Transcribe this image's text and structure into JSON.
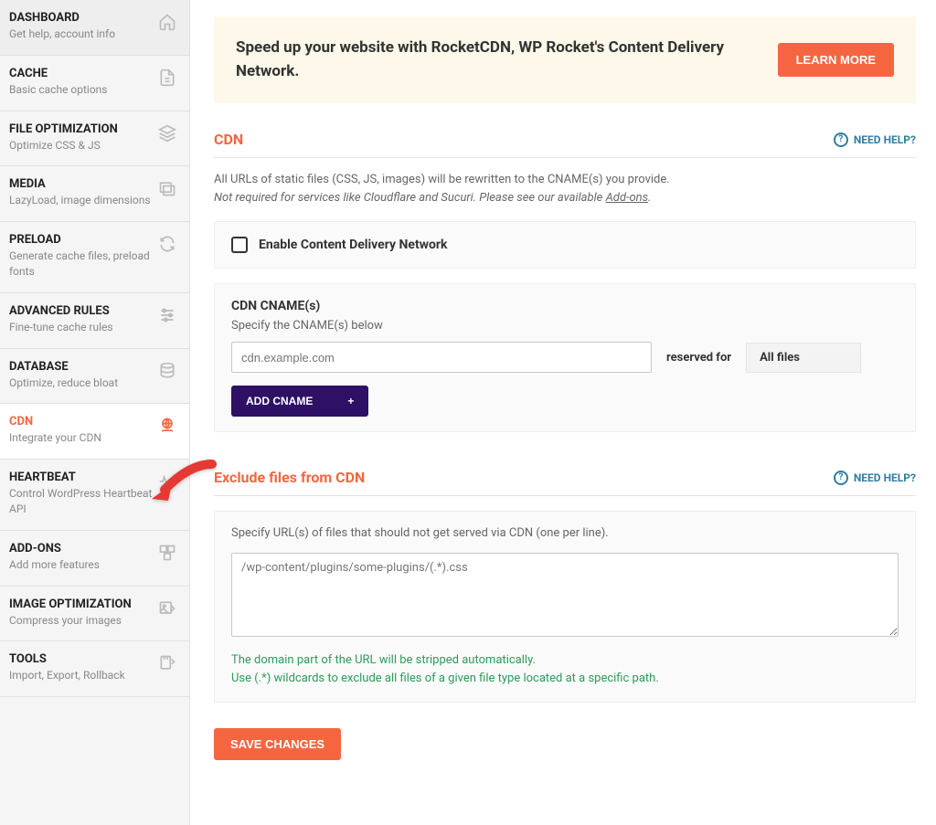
{
  "sidebar": {
    "items": [
      {
        "title": "DASHBOARD",
        "sub": "Get help, account info",
        "icon": "home"
      },
      {
        "title": "CACHE",
        "sub": "Basic cache options",
        "icon": "file"
      },
      {
        "title": "FILE OPTIMIZATION",
        "sub": "Optimize CSS & JS",
        "icon": "layers"
      },
      {
        "title": "MEDIA",
        "sub": "LazyLoad, image dimensions",
        "icon": "images"
      },
      {
        "title": "PRELOAD",
        "sub": "Generate cache files, preload fonts",
        "icon": "refresh"
      },
      {
        "title": "ADVANCED RULES",
        "sub": "Fine-tune cache rules",
        "icon": "sliders"
      },
      {
        "title": "DATABASE",
        "sub": "Optimize, reduce bloat",
        "icon": "database"
      },
      {
        "title": "CDN",
        "sub": "Integrate your CDN",
        "icon": "globe-hand",
        "active": true
      },
      {
        "title": "HEARTBEAT",
        "sub": "Control WordPress Heartbeat API",
        "icon": "heartbeat"
      },
      {
        "title": "ADD-ONS",
        "sub": "Add more features",
        "icon": "blocks"
      },
      {
        "title": "IMAGE OPTIMIZATION",
        "sub": "Compress your images",
        "icon": "image-opt"
      },
      {
        "title": "TOOLS",
        "sub": "Import, Export, Rollback",
        "icon": "tools"
      }
    ]
  },
  "promo": {
    "msg": "Speed up your website with RocketCDN, WP Rocket's Content Delivery Network.",
    "cta": "LEARN MORE"
  },
  "cdn": {
    "heading": "CDN",
    "need_help": "NEED HELP?",
    "desc_line1": "All URLs of static files (CSS, JS, images) will be rewritten to the CNAME(s) you provide.",
    "desc_line2_prefix": "Not required for services like Cloudflare and Sucuri. Please see our available ",
    "desc_line2_link": "Add-ons",
    "desc_line2_suffix": ".",
    "enable_label": "Enable Content Delivery Network",
    "cname_title": "CDN CNAME(s)",
    "cname_sub": "Specify the CNAME(s) below",
    "cname_placeholder": "cdn.example.com",
    "reserved_label": "reserved for",
    "reserved_value": "All files",
    "add_cname": "ADD CNAME"
  },
  "exclude": {
    "heading": "Exclude files from CDN",
    "need_help": "NEED HELP?",
    "sub": "Specify URL(s) of files that should not get served via CDN (one per line).",
    "placeholder": "/wp-content/plugins/some-plugins/(.*).css",
    "hint1": "The domain part of the URL will be stripped automatically.",
    "hint2": "Use (.*) wildcards to exclude all files of a given file type located at a specific path."
  },
  "save": "SAVE CHANGES"
}
